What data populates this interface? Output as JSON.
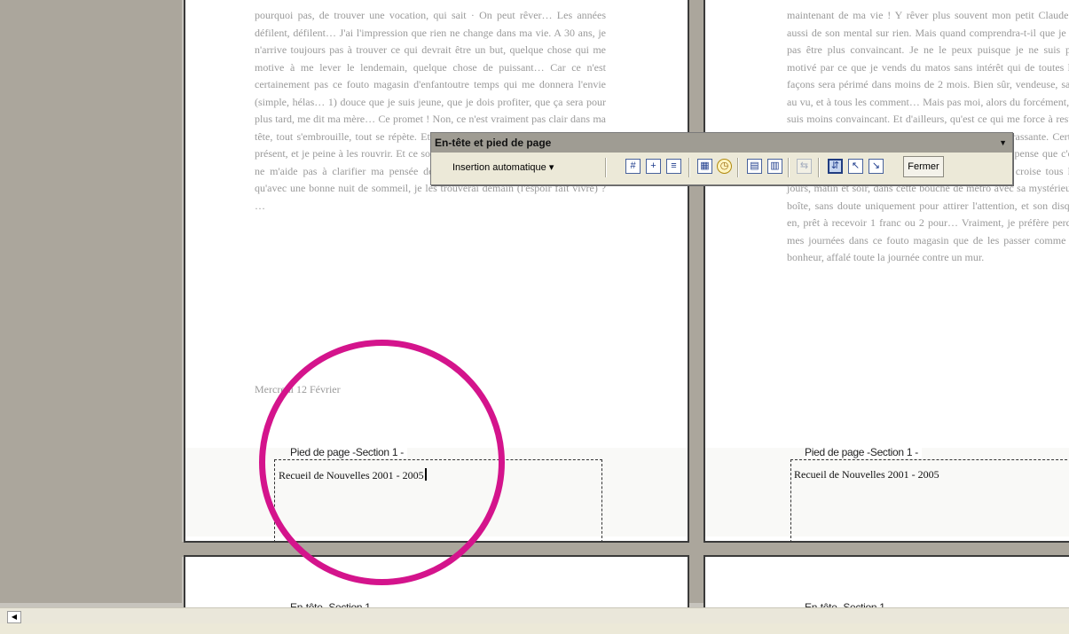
{
  "left_page": {
    "body_lines": "pourquoi pas, de trouver une vocation, qui sait · On peut rêver… Les années défilent, défilent… J'ai l'impression que rien ne change dans ma vie. A 30 ans, je n'arrive toujours pas à trouver ce qui devrait être un but, quelque chose qui me motive à me lever le lendemain, quelque chose de puissant… Car ce n'est certainement pas ce fouto magasin d'enfantoutre temps qui me donnera l'envie (simple, hélas… 1) douce que je suis jeune, que je dois profiter, que ça sera pour plus tard, me dit ma mère… Ce promet ! Non, ce n'est vraiment pas clair dans ma tête, tout s'embrouille, tout se répète. Et voilà que j'ai les yeux qui se ferment à présent, et je peine à les rouvrir. Et ce sont qui roule quoi de plus énervant ? Cela ne m'aide pas à clarifier ma pensée déjà très floue. Allez, qui sait, peut-être qu'avec une bonne nuit de sommeil, je les trouverai demain (l'espoir fait vivre) ? …",
    "date_line": "Mercredi 12 Février",
    "footer_label": "Pied de page -Section 1 -",
    "footer_text": "Recueil de Nouvelles 2001 - 2005"
  },
  "right_page": {
    "body_lines": "maintenant de ma vie ! Y rêver plus souvent mon petit Claude s, aussi de son mental sur rien. Mais quand comprendra-t-il que je ne pas être plus convaincant. Je ne le peux puisque je ne suis pas motivé par ce que je vends du matos sans intérêt qui de toutes les façons sera périmé dans moins de 2 mois. Bien sûr, vendeuse, sans au vu, et à tous les comment… Mais pas moi, alors du forcément, je suis moins convaincant. Et d'ailleurs, qu'est ce qui me force à rester bosser dans ce magasin ? C'est une question embarrassante. Certes ce n'est pas l'intérêt que j'y porte. Alors… Alors, je pense que c'est bien pour me rassembler à ce dictionnaire, que je croise tous les jours, matin et soir, dans cette bouche de métro avec sa mystérieuse boîte, sans doute uniquement pour attirer l'attention, et son disque en, prêt à recevoir 1 franc ou 2 pour… Vraiment, je préfère perdre mes journées dans ce fouto magasin que de les passer comme ce bonheur, affalé toute la journée contre un mur.",
    "footer_label": "Pied de page -Section 1 -",
    "footer_text": "Recueil de Nouvelles 2001 - 2005"
  },
  "next_pages": {
    "left_header_label": "En-tête -Section 1 -",
    "right_header_label": "En-tête -Section 1 -"
  },
  "toolbar": {
    "title": "En-tête et pied de page",
    "insert_auto_label": "Insertion automatique ▾",
    "close_label": "Fermer",
    "icons": [
      "page-number-icon",
      "page-count-icon",
      "format-page-number-icon",
      "insert-date-icon",
      "insert-time-icon",
      "page-setup-icon",
      "show-hide-text-icon",
      "same-as-previous-icon",
      "switch-header-footer-icon",
      "show-previous-icon",
      "show-next-icon"
    ]
  },
  "annotation": {
    "color": "#d4148c"
  }
}
